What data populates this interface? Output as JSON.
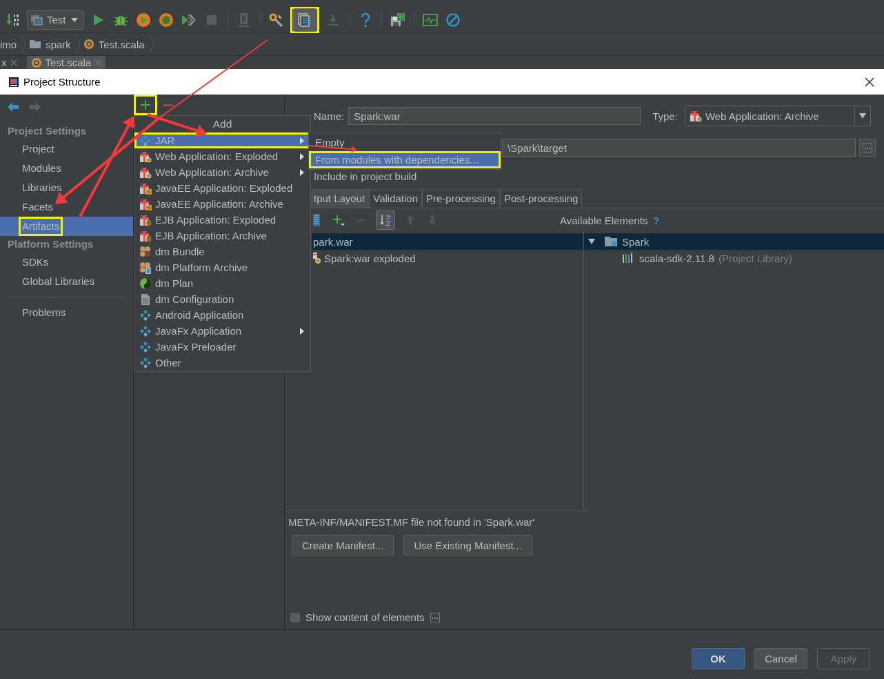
{
  "ide": {
    "toolbar": [
      {
        "kind": "binary",
        "highlighted": false
      },
      {
        "kind": "run_config",
        "label": "Test",
        "highlighted": false
      },
      {
        "kind": "run",
        "highlighted": false
      },
      {
        "kind": "debug",
        "highlighted": false
      },
      {
        "kind": "coverage",
        "highlighted": false
      },
      {
        "kind": "profile",
        "highlighted": false
      },
      {
        "kind": "grid",
        "highlighted": false
      },
      {
        "kind": "stop",
        "highlighted": false
      },
      {
        "kind": "separator"
      },
      {
        "kind": "device",
        "highlighted": false
      },
      {
        "kind": "separator"
      },
      {
        "kind": "tools",
        "highlighted": false
      },
      {
        "kind": "structure",
        "highlighted": true
      },
      {
        "kind": "download",
        "highlighted": false
      },
      {
        "kind": "separator"
      },
      {
        "kind": "help",
        "highlighted": false
      },
      {
        "kind": "separator"
      },
      {
        "kind": "sdk",
        "highlighted": false
      },
      {
        "kind": "separator"
      },
      {
        "kind": "monitor",
        "highlighted": false
      },
      {
        "kind": "block",
        "highlighted": false
      }
    ],
    "breadcrumbs": [
      {
        "label": "imo"
      },
      {
        "label": "spark",
        "kind": "folder"
      },
      {
        "label": "Test.scala",
        "kind": "scala"
      }
    ],
    "editor_tabs": [
      {
        "label": "x",
        "selected": false
      },
      {
        "label": "Test.scala",
        "kind": "scala",
        "selected": true
      }
    ]
  },
  "dialog": {
    "title": "Project Structure",
    "sidebar": {
      "sections": [
        {
          "title": "Project Settings",
          "items": [
            {
              "label": "Project",
              "selected": false,
              "highlighted": false
            },
            {
              "label": "Modules",
              "selected": false,
              "highlighted": false
            },
            {
              "label": "Libraries",
              "selected": false,
              "highlighted": false
            },
            {
              "label": "Facets",
              "selected": false,
              "highlighted": false
            },
            {
              "label": "Artifacts",
              "selected": true,
              "highlighted": true
            }
          ]
        },
        {
          "title": "Platform Settings",
          "items": [
            {
              "label": "SDKs",
              "selected": false,
              "highlighted": false
            },
            {
              "label": "Global Libraries",
              "selected": false,
              "highlighted": false
            }
          ]
        }
      ],
      "extra_items": [
        {
          "label": "Problems",
          "selected": false,
          "highlighted": false
        }
      ]
    },
    "artifact_tools": [
      {
        "kind": "add",
        "highlighted": true
      },
      {
        "kind": "remove",
        "highlighted": false
      }
    ],
    "name": {
      "label": "Name:",
      "value": "Spark:war"
    },
    "type": {
      "label": "Type:",
      "value": "Web Application: Archive"
    },
    "output_directory": {
      "value": "\\Spark\\target"
    },
    "include_in_build": "Include in project build",
    "tabs": [
      {
        "label": "tput Layout",
        "selected": true
      },
      {
        "label": "Validation",
        "selected": false
      },
      {
        "label": "Pre-processing",
        "selected": false
      },
      {
        "label": "Post-processing",
        "selected": false
      }
    ],
    "layout_tools": [
      {
        "kind": "archive",
        "on": false
      },
      {
        "kind": "add",
        "on": false
      },
      {
        "kind": "remove",
        "on": false
      },
      {
        "kind": "sort",
        "on": true
      },
      {
        "kind": "up",
        "on": false
      },
      {
        "kind": "down",
        "on": false
      }
    ],
    "available_elements": {
      "label": "Available Elements",
      "help_mark": "?"
    },
    "output_tree": [
      {
        "label": "park.war",
        "selected": true,
        "children": [
          {
            "label": "Spark:war exploded",
            "selected": false
          }
        ]
      }
    ],
    "available_tree": [
      {
        "label": "Spark",
        "expanded": true,
        "selected": true,
        "children": [
          {
            "label": "scala-sdk-2.11.8",
            "note": "(Project Library)",
            "selected": false
          }
        ]
      }
    ],
    "manifest_message": "META-INF/MANIFEST.MF file not found in 'Spark.war'",
    "manifest_buttons": [
      "Create Manifest...",
      "Use Existing Manifest..."
    ],
    "show_content": {
      "label": "Show content of elements",
      "checked": false
    },
    "footer_buttons": [
      {
        "label": "OK",
        "kind": "default",
        "disabled": false
      },
      {
        "label": "Cancel",
        "kind": "normal",
        "disabled": false
      },
      {
        "label": "Apply",
        "kind": "normal",
        "disabled": true
      }
    ]
  },
  "add_menu": {
    "title": "Add",
    "items": [
      {
        "label": "JAR",
        "kind": "diamonds",
        "submenu": true,
        "selected": true,
        "highlighted": true
      },
      {
        "label": "Web Application: Exploded",
        "kind": "gift",
        "submenu": true,
        "selected": false,
        "highlighted": false
      },
      {
        "label": "Web Application: Archive",
        "kind": "gift",
        "submenu": true,
        "selected": false,
        "highlighted": false
      },
      {
        "label": "JavaEE Application: Exploded",
        "kind": "gift_ee",
        "submenu": false,
        "selected": false,
        "highlighted": false
      },
      {
        "label": "JavaEE Application: Archive",
        "kind": "gift_ee",
        "submenu": false,
        "selected": false,
        "highlighted": false
      },
      {
        "label": "EJB Application: Exploded",
        "kind": "gift_ejb",
        "submenu": false,
        "selected": false,
        "highlighted": false
      },
      {
        "label": "EJB Application: Archive",
        "kind": "gift_ejb",
        "submenu": false,
        "selected": false,
        "highlighted": false
      },
      {
        "label": "dm Bundle",
        "kind": "bundle",
        "submenu": false,
        "selected": false,
        "highlighted": false
      },
      {
        "label": "dm Platform Archive",
        "kind": "platform",
        "submenu": false,
        "selected": false,
        "highlighted": false
      },
      {
        "label": "dm Plan",
        "kind": "globe",
        "submenu": false,
        "selected": false,
        "highlighted": false
      },
      {
        "label": "dm Configuration",
        "kind": "doc",
        "submenu": false,
        "selected": false,
        "highlighted": false
      },
      {
        "label": "Android Application",
        "kind": "diamonds",
        "submenu": false,
        "selected": false,
        "highlighted": false
      },
      {
        "label": "JavaFx Application",
        "kind": "diamonds",
        "submenu": true,
        "selected": false,
        "highlighted": false
      },
      {
        "label": "JavaFx Preloader",
        "kind": "diamonds",
        "submenu": false,
        "selected": false,
        "highlighted": false
      },
      {
        "label": "Other",
        "kind": "diamonds",
        "submenu": false,
        "selected": false,
        "highlighted": false
      }
    ]
  },
  "jar_submenu": {
    "items": [
      {
        "label": "Empty",
        "selected": false,
        "highlighted": false
      },
      {
        "label": "From modules with dependencies...",
        "selected": true,
        "highlighted": true
      }
    ]
  }
}
